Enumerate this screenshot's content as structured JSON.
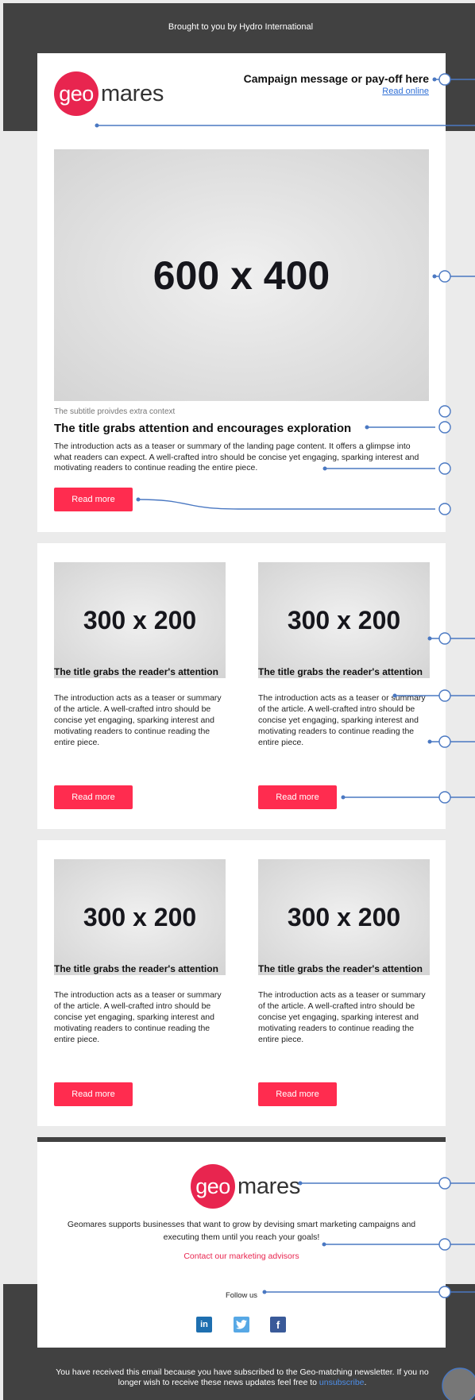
{
  "preheader": {
    "text": "Brought to you by Hydro International"
  },
  "header": {
    "logo_circle": "geo",
    "logo_word": "mares",
    "campaign": "Campaign message or pay-off here",
    "read_online": "Read online"
  },
  "hero": {
    "placeholder": "600 x 400",
    "subtitle": "The subtitle proivdes extra context",
    "title": "The title grabs attention and encourages exploration",
    "intro": "The introduction acts as a teaser or summary of the landing page content. It offers a glimpse into what readers can expect. A well-crafted intro should be concise yet engaging, sparking interest and motivating readers to continue reading the entire piece.",
    "button": "Read more"
  },
  "articles": [
    {
      "placeholder": "300 x 200",
      "title": "The title grabs the reader's attention",
      "intro": "The introduction acts as a teaser or summary of the article. A well-crafted intro should be concise yet engaging, sparking interest and motivating readers to continue reading the entire piece.",
      "button": "Read more"
    },
    {
      "placeholder": "300 x 200",
      "title": "The title grabs the reader's attention",
      "intro": "The introduction acts as a teaser or summary of the article. A well-crafted intro should be concise yet engaging, sparking interest and motivating readers to continue reading the entire piece.",
      "button": "Read more"
    },
    {
      "placeholder": "300 x 200",
      "title": "The title grabs the reader's attention",
      "intro": "The introduction acts as a teaser or summary of the article. A well-crafted intro should be concise yet engaging, sparking interest and motivating readers to continue reading the entire piece.",
      "button": "Read more"
    },
    {
      "placeholder": "300 x 200",
      "title": "The title grabs the reader's attention",
      "intro": "The introduction acts as a teaser or summary of the article. A well-crafted intro should be concise yet engaging, sparking interest and motivating readers to continue reading the entire piece.",
      "button": "Read more"
    }
  ],
  "footer": {
    "logo_circle": "geo",
    "logo_word": "mares",
    "text": "Geomares supports businesses that want to grow by devising smart marketing campaigns and executing them until you reach your goals!",
    "contact": "Contact our marketing advisors",
    "follow": "Follow us",
    "social": {
      "linkedin": "in",
      "twitter": "t",
      "facebook": "f"
    }
  },
  "legal": {
    "text": "You have received this email because you have subscribed to the Geo-matching newsletter. If you no longer wish to receive these news updates feel free to",
    "unsubscribe": "unsubscribe",
    "end": "."
  },
  "colors": {
    "brand": "#e8254f",
    "button": "#ff2c4f",
    "dark": "#414141",
    "annotation": "#4a78c2",
    "link": "#2f6fd6"
  }
}
